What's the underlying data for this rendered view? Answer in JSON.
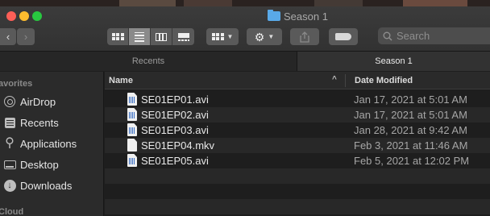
{
  "window": {
    "title": "Season 1"
  },
  "toolbar": {
    "back_label": "‹",
    "forward_label": "›",
    "views": [
      "icon-view",
      "list-view",
      "column-view",
      "gallery-view"
    ],
    "active_view": "list-view",
    "search_placeholder": "Search"
  },
  "tabs": [
    {
      "label": "Recents",
      "active": false
    },
    {
      "label": "Season 1",
      "active": true
    }
  ],
  "sidebar": {
    "favorites_header": "avorites",
    "cloud_header": "Cloud",
    "items": [
      {
        "label": "AirDrop",
        "icon": "airdrop-icon"
      },
      {
        "label": "Recents",
        "icon": "recents-icon"
      },
      {
        "label": "Applications",
        "icon": "applications-icon"
      },
      {
        "label": "Desktop",
        "icon": "desktop-icon"
      },
      {
        "label": "Downloads",
        "icon": "downloads-icon"
      }
    ]
  },
  "list": {
    "col_name": "Name",
    "col_date": "Date Modified",
    "rows": [
      {
        "name": "SE01EP01.avi",
        "date": "Jan 17, 2021 at 5:01 AM",
        "icon": "video-file-icon"
      },
      {
        "name": "SE01EP02.avi",
        "date": "Jan 17, 2021 at 5:01 AM",
        "icon": "video-file-icon"
      },
      {
        "name": "SE01EP03.avi",
        "date": "Jan 28, 2021 at 9:42 AM",
        "icon": "video-file-icon"
      },
      {
        "name": "SE01EP04.mkv",
        "date": "Feb 3, 2021 at 11:46 AM",
        "icon": "document-file-icon"
      },
      {
        "name": "SE01EP05.avi",
        "date": "Feb 5, 2021 at 12:02 PM",
        "icon": "video-file-icon"
      }
    ]
  },
  "colors": {
    "accent": "#59a9e8",
    "close": "#fd5f57",
    "minimize": "#febc2e",
    "maximize": "#28c840"
  }
}
